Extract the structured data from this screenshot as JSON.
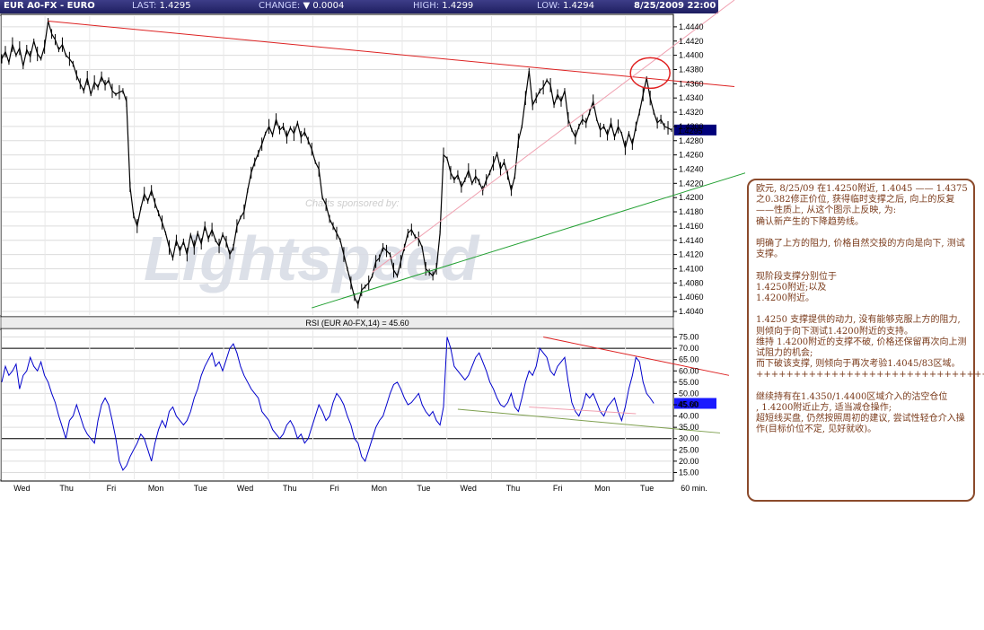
{
  "header": {
    "symbol": "EUR A0-FX - EURO",
    "last_label": "LAST:",
    "last_value": "1.4295",
    "change_label": "CHANGE:",
    "change_arrow": "▼",
    "change_value": "0.0004",
    "high_label": "HIGH:",
    "high_value": "1.4299",
    "low_label": "LOW:",
    "low_value": "1.4294",
    "datetime": "8/25/2009 22:00"
  },
  "watermark": {
    "sponsor_text": "Charts sponsored by:",
    "logo_text": "Lightspeed"
  },
  "colors": {
    "price_line": "#000000",
    "rsi_line": "#0000cc",
    "resistance_line": "#dd2222",
    "support_line": "#22a032",
    "pink_line": "#f0a0b0",
    "annotation_border": "#8b4a2b",
    "annotation_text": "#7a3a1a",
    "label_box": "#00007a"
  },
  "chart_data": [
    {
      "type": "line",
      "name": "price",
      "x_labels": [
        "Wed",
        "Thu",
        "Fri",
        "Mon",
        "Tue",
        "Wed",
        "Thu",
        "Fri",
        "Mon",
        "Tue",
        "Wed",
        "Thu",
        "Fri",
        "Mon",
        "Tue"
      ],
      "interval_label": "60 min.",
      "y_ticks": [
        "1.4440",
        "1.4420",
        "1.4400",
        "1.4380",
        "1.4360",
        "1.4340",
        "1.4320",
        "1.4300",
        "1.4280",
        "1.4260",
        "1.4240",
        "1.4220",
        "1.4200",
        "1.4180",
        "1.4160",
        "1.4140",
        "1.4120",
        "1.4100",
        "1.4080",
        "1.4060",
        "1.4040"
      ],
      "ylim": [
        1.4035,
        1.4455
      ],
      "last_value_label": "1.4295",
      "series": [
        {
          "values": [
            1.4395,
            1.4405,
            1.439,
            1.4415,
            1.44,
            1.441,
            1.4385,
            1.4408,
            1.4398,
            1.442,
            1.4402,
            1.4395,
            1.4412,
            1.4448,
            1.443,
            1.4422,
            1.4408,
            1.4415,
            1.44,
            1.4395,
            1.4388,
            1.4372,
            1.436,
            1.435,
            1.4368,
            1.4345,
            1.4362,
            1.4355,
            1.437,
            1.4358,
            1.4365,
            1.435,
            1.4345,
            1.4348,
            1.435,
            1.4335,
            1.4215,
            1.4175,
            1.416,
            1.4185,
            1.4205,
            1.4195,
            1.421,
            1.4192,
            1.4178,
            1.4165,
            1.415,
            1.413,
            1.4115,
            1.414,
            1.4125,
            1.4138,
            1.412,
            1.4148,
            1.413,
            1.415,
            1.4135,
            1.416,
            1.4142,
            1.4155,
            1.414,
            1.4132,
            1.4148,
            1.4138,
            1.412,
            1.413,
            1.416,
            1.4172,
            1.418,
            1.421,
            1.4235,
            1.425,
            1.4262,
            1.4275,
            1.429,
            1.43,
            1.4288,
            1.431,
            1.4295,
            1.43,
            1.4285,
            1.4298,
            1.429,
            1.4305,
            1.4285,
            1.4292,
            1.428,
            1.4268,
            1.425,
            1.424,
            1.42,
            1.419,
            1.417,
            1.416,
            1.415,
            1.414,
            1.412,
            1.41,
            1.408,
            1.406,
            1.405,
            1.407,
            1.4075,
            1.408,
            1.409,
            1.411,
            1.4115,
            1.413,
            1.4125,
            1.412,
            1.4098,
            1.409,
            1.411,
            1.413,
            1.415,
            1.4155,
            1.4145,
            1.4142,
            1.413,
            1.41,
            1.4095,
            1.409,
            1.41,
            1.415,
            1.426,
            1.4255,
            1.4235,
            1.4225,
            1.4232,
            1.4215,
            1.4225,
            1.4238,
            1.422,
            1.423,
            1.4222,
            1.421,
            1.4225,
            1.4235,
            1.4248,
            1.4262,
            1.424,
            1.425,
            1.4232,
            1.421,
            1.423,
            1.428,
            1.43,
            1.434,
            1.4378,
            1.433,
            1.434,
            1.435,
            1.4355,
            1.4365,
            1.4358,
            1.433,
            1.4345,
            1.4335,
            1.435,
            1.431,
            1.4295,
            1.4285,
            1.43,
            1.431,
            1.4305,
            1.432,
            1.4335,
            1.431,
            1.4295,
            1.43,
            1.4288,
            1.4305,
            1.4285,
            1.43,
            1.429,
            1.427,
            1.429,
            1.4275,
            1.43,
            1.432,
            1.4345,
            1.4368,
            1.434,
            1.432,
            1.4305,
            1.431,
            1.43,
            1.4298,
            1.4295
          ]
        }
      ],
      "annotations": {
        "resistance_line": {
          "x": [
            13,
            190
          ],
          "y": [
            1.4448,
            1.436
          ]
        },
        "support_line": {
          "x": [
            87,
            202
          ],
          "y": [
            1.4045,
            1.4268
          ]
        },
        "pink_line": {
          "x": [
            104,
            175
          ],
          "y": [
            1.4095,
            1.434
          ]
        },
        "circle_center": {
          "x": 182,
          "y": 1.4375
        }
      }
    },
    {
      "type": "line",
      "name": "rsi",
      "title": "RSI (EUR A0-FX,14) = 45.60",
      "y_ticks": [
        "75.00",
        "70.00",
        "65.00",
        "60.00",
        "55.00",
        "50.00",
        "45.00",
        "40.00",
        "35.00",
        "30.00",
        "25.00",
        "20.00",
        "15.00"
      ],
      "ylim": [
        12,
        78
      ],
      "hlines": [
        70,
        30
      ],
      "last_value_label": "45.60",
      "series": [
        {
          "values": [
            55,
            62,
            58,
            60,
            63,
            52,
            58,
            60,
            66,
            62,
            60,
            64,
            58,
            55,
            50,
            46,
            40,
            35,
            30,
            38,
            40,
            45,
            40,
            35,
            32,
            30,
            28,
            38,
            45,
            48,
            45,
            38,
            30,
            20,
            16,
            18,
            22,
            25,
            28,
            32,
            30,
            25,
            20,
            28,
            34,
            38,
            35,
            42,
            44,
            40,
            38,
            36,
            38,
            42,
            48,
            52,
            58,
            62,
            65,
            68,
            62,
            64,
            60,
            65,
            70,
            72,
            68,
            62,
            58,
            55,
            52,
            50,
            48,
            42,
            40,
            38,
            34,
            32,
            30,
            32,
            36,
            38,
            35,
            30,
            32,
            28,
            30,
            35,
            40,
            45,
            42,
            38,
            40,
            46,
            50,
            48,
            45,
            40,
            36,
            30,
            28,
            22,
            20,
            25,
            30,
            35,
            38,
            40,
            45,
            50,
            54,
            55,
            52,
            48,
            45,
            46,
            48,
            50,
            45,
            42,
            40,
            42,
            38,
            36,
            44,
            75,
            70,
            62,
            60,
            58,
            56,
            58,
            62,
            66,
            68,
            64,
            60,
            55,
            52,
            48,
            45,
            44,
            46,
            50,
            44,
            42,
            48,
            55,
            60,
            58,
            62,
            70,
            68,
            66,
            60,
            58,
            62,
            64,
            66,
            55,
            46,
            42,
            40,
            44,
            50,
            48,
            50,
            46,
            42,
            40,
            44,
            46,
            48,
            42,
            38,
            44,
            52,
            58,
            66,
            64,
            55,
            50,
            48,
            45.6
          ]
        }
      ],
      "annotations": {
        "pink_downtrend": {
          "x": [
            152,
            190
          ],
          "y": [
            75,
            61
          ]
        },
        "green_support": {
          "x": [
            128,
            202
          ],
          "y": [
            43,
            33
          ]
        },
        "pink_bottom": {
          "x": [
            148,
            178
          ],
          "y": [
            44,
            41
          ]
        }
      }
    }
  ],
  "annotation_text": "欧元, 8/25/09 在1.4250附近, 1.4045 —— 1.4375 之0.382修正价位, 获得临时支撑之后, 向上的反复\n——性质上, 从这个图示上反映, 为:\n确认新产生的下降趋势线。\n\n明确了上方的阻力, 价格自然交投的方向是向下, 测试支撑。\n\n现阶段支撑分别位于\n1.4250附近;以及\n1.4200附近。\n\n1.4250 支撑提供的动力, 没有能够克服上方的阻力, 则倾向于向下测试1.4200附近的支持。\n维持 1.4200附近的支撑不破, 价格还保留再次向上测试阻力的机会;\n而下破该支撑, 则倾向于再次考验1.4045/83区域。\n+++++++++++++++++++++++++++++++++\n\n继续持有在1.4350/1.4400区域介入的沽空仓位\n, 1.4200附近止方, 适当减仓操作;\n超短线买盘, 仍然按照周初的建议, 尝试性轻仓介入操作(目标价位不定, 见好就收)。"
}
